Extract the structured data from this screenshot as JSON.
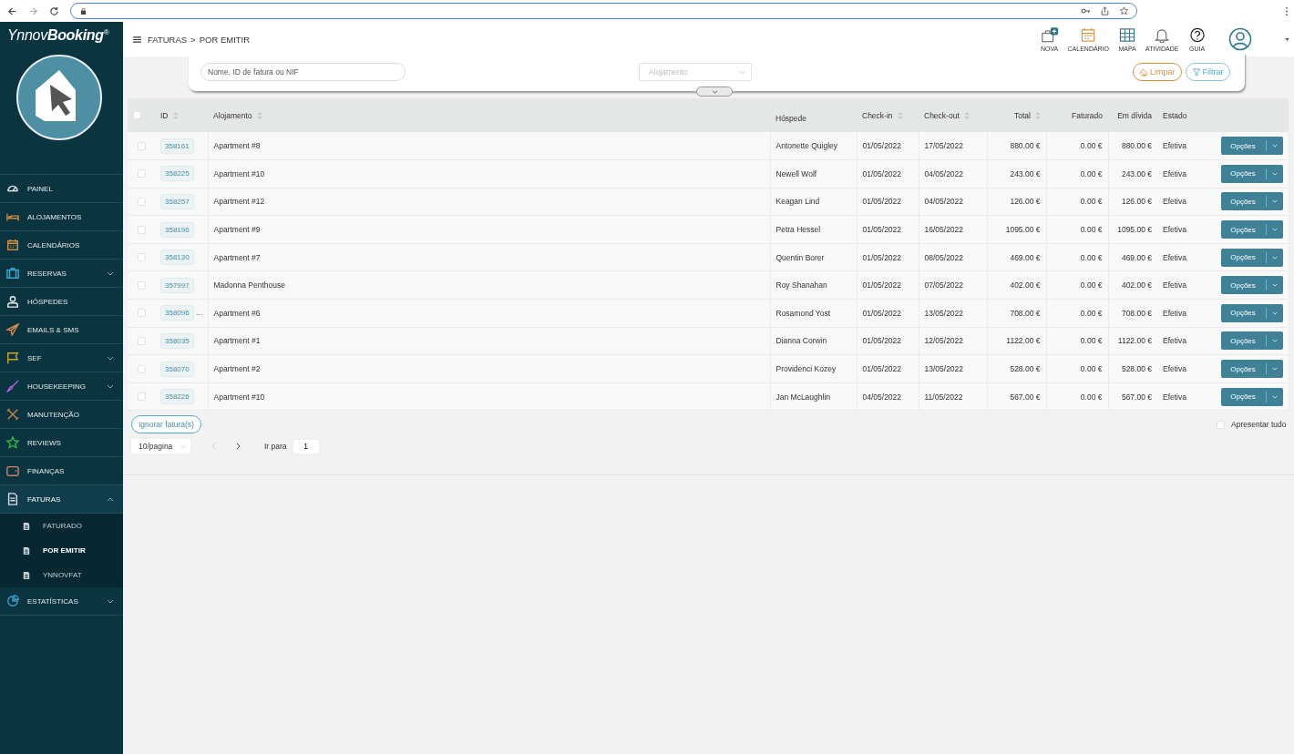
{
  "app": {
    "logo": "Ynnov**Booking**$^{®}$"
  },
  "sidebar": {
    "items": [
      {
        "label": "PAINEL",
        "color": "#e8eef0",
        "kind": "link",
        "expanded": false
      },
      {
        "label": "ALOJAMENTOS",
        "color": "#c98a3c",
        "kind": "link",
        "expanded": false
      },
      {
        "label": "CALENDÁRIOS",
        "color": "#d4923e",
        "kind": "link",
        "expanded": false
      },
      {
        "label": "RESERVAS",
        "color": "#3fa9d0",
        "kind": "group",
        "expanded": false
      },
      {
        "label": "HÓSPEDES",
        "color": "#e8eef0",
        "kind": "link",
        "expanded": false
      },
      {
        "label": "EMAILS & SMS",
        "color": "#d08a50",
        "kind": "link",
        "expanded": false
      },
      {
        "label": "SEF",
        "color": "#c9a52a",
        "kind": "group",
        "expanded": false
      },
      {
        "label": "HOUSEKEEPING",
        "color": "#b466d6",
        "kind": "group",
        "expanded": false
      },
      {
        "label": "MANUTENÇÃO",
        "color": "#c98446",
        "kind": "link",
        "expanded": false
      },
      {
        "label": "REVIEWS",
        "color": "#2fb54a",
        "kind": "link",
        "expanded": false
      },
      {
        "label": "FINANÇAS",
        "color": "#d0806e",
        "kind": "link",
        "expanded": false
      },
      {
        "label": "FATURAS",
        "color": "#d8e0e3",
        "kind": "group",
        "expanded": true,
        "children": [
          {
            "label": "FATURADO",
            "selected": false
          },
          {
            "label": "POR EMITIR",
            "selected": true
          },
          {
            "label": "YNNOVFAT",
            "selected": false
          }
        ]
      },
      {
        "label": "ESTATÍSTICAS",
        "color": "#3aa0c8",
        "kind": "group",
        "expanded": false
      }
    ]
  },
  "header": {
    "breadcrumb": [
      "FATURAS",
      "POR EMITIR"
    ],
    "separator": ">",
    "actions": [
      {
        "label": "NOVA"
      },
      {
        "label": "CALENDÁRIO"
      },
      {
        "label": "MAPA"
      },
      {
        "label": "ATIVIDADE"
      },
      {
        "label": "GUIA"
      }
    ]
  },
  "filters": {
    "search": {
      "placeholder": "Nome, ID de fatura ou NIF"
    },
    "select": {
      "placeholder": "Alojamento"
    },
    "clear_button": "Limpar",
    "filter_button": "Filtrar"
  },
  "table": {
    "select_all": {
      "checked": false
    },
    "columns": [
      {
        "label": "ID",
        "sortable": true
      },
      {
        "label": "Alojamento",
        "sortable": true
      },
      {
        "label": "Hóspede",
        "sortable": false
      },
      {
        "label": "Check-in",
        "sortable": true
      },
      {
        "label": "Check-out",
        "sortable": true
      },
      {
        "label": "Total",
        "sortable": true
      },
      {
        "label": "Faturado",
        "sortable": false
      },
      {
        "label": "Em dívida",
        "sortable": false
      },
      {
        "label": "Estado",
        "sortable": false
      }
    ],
    "rows": [
      {
        "checked": false,
        "id": "358161",
        "alojamento": "Apartment #8",
        "hospede": "Antonette Quigley",
        "check_in": "01/05/2022",
        "check_out": "17/05/2022",
        "total": "880.00 €",
        "faturado": "0.00 €",
        "em_divida": "880.00 €",
        "estado": "Efetiva",
        "action": "Opções"
      },
      {
        "checked": false,
        "id": "358225",
        "alojamento": "Apartment #10",
        "hospede": "Newell Wolf",
        "check_in": "01/05/2022",
        "check_out": "04/05/2022",
        "total": "243.00 €",
        "faturado": "0.00 €",
        "em_divida": "243.00 €",
        "estado": "Efetiva",
        "action": "Opções"
      },
      {
        "checked": false,
        "id": "358257",
        "alojamento": "Apartment #12",
        "hospede": "Keagan Lind",
        "check_in": "01/05/2022",
        "check_out": "04/05/2022",
        "total": "126.00 €",
        "faturado": "0.00 €",
        "em_divida": "126.00 €",
        "estado": "Efetiva",
        "action": "Opções"
      },
      {
        "checked": false,
        "id": "358196",
        "alojamento": "Apartment #9",
        "hospede": "Petra Hessel",
        "check_in": "01/05/2022",
        "check_out": "16/05/2022",
        "total": "1095.00 €",
        "faturado": "0.00 €",
        "em_divida": "1095.00 €",
        "estado": "Efetiva",
        "action": "Opções"
      },
      {
        "checked": false,
        "id": "358130",
        "alojamento": "Apartment #7",
        "hospede": "Quentin Borer",
        "check_in": "01/05/2022",
        "check_out": "08/05/2022",
        "total": "469.00 €",
        "faturado": "0.00 €",
        "em_divida": "469.00 €",
        "estado": "Efetiva",
        "action": "Opções"
      },
      {
        "checked": false,
        "id": "357997",
        "alojamento": "Madonna Penthouse",
        "hospede": "Roy Shanahan",
        "check_in": "01/05/2022",
        "check_out": "07/05/2022",
        "total": "402.00 €",
        "faturado": "0.00 €",
        "em_divida": "402.00 €",
        "estado": "Efetiva",
        "action": "Opções"
      },
      {
        "checked": false,
        "id": "358096",
        "id_more": "…",
        "alojamento": "Apartment #6",
        "hospede": "Rosamond Yost",
        "check_in": "01/05/2022",
        "check_out": "13/05/2022",
        "total": "708.00 €",
        "faturado": "0.00 €",
        "em_divida": "708.00 €",
        "estado": "Efetiva",
        "action": "Opções"
      },
      {
        "checked": false,
        "id": "358035",
        "alojamento": "Apartment #1",
        "hospede": "Dianna Corwin",
        "check_in": "01/05/2022",
        "check_out": "12/05/2022",
        "total": "1122.00 €",
        "faturado": "0.00 €",
        "em_divida": "1122.00 €",
        "estado": "Efetiva",
        "action": "Opções"
      },
      {
        "checked": false,
        "id": "358070",
        "alojamento": "Apartment #2",
        "hospede": "Providenci Kozey",
        "check_in": "01/05/2022",
        "check_out": "13/05/2022",
        "total": "528.00 €",
        "faturado": "0.00 €",
        "em_divida": "528.00 €",
        "estado": "Efetiva",
        "action": "Opções"
      },
      {
        "checked": false,
        "id": "358226",
        "alojamento": "Apartment #10",
        "hospede": "Jan McLaughlin",
        "check_in": "04/05/2022",
        "check_out": "11/05/2022",
        "total": "567.00 €",
        "faturado": "0.00 €",
        "em_divida": "567.00 €",
        "estado": "Efetiva",
        "action": "Opções"
      }
    ]
  },
  "footer": {
    "ignore_button": "Ignorar fatura(s)",
    "show_all": {
      "label": "Apresentar tudo",
      "checked": false
    },
    "pagination": {
      "page_size": "10/pagina",
      "prev_disabled": true,
      "next_disabled": false,
      "goto_label": "Ir para",
      "goto_value": "1"
    }
  }
}
